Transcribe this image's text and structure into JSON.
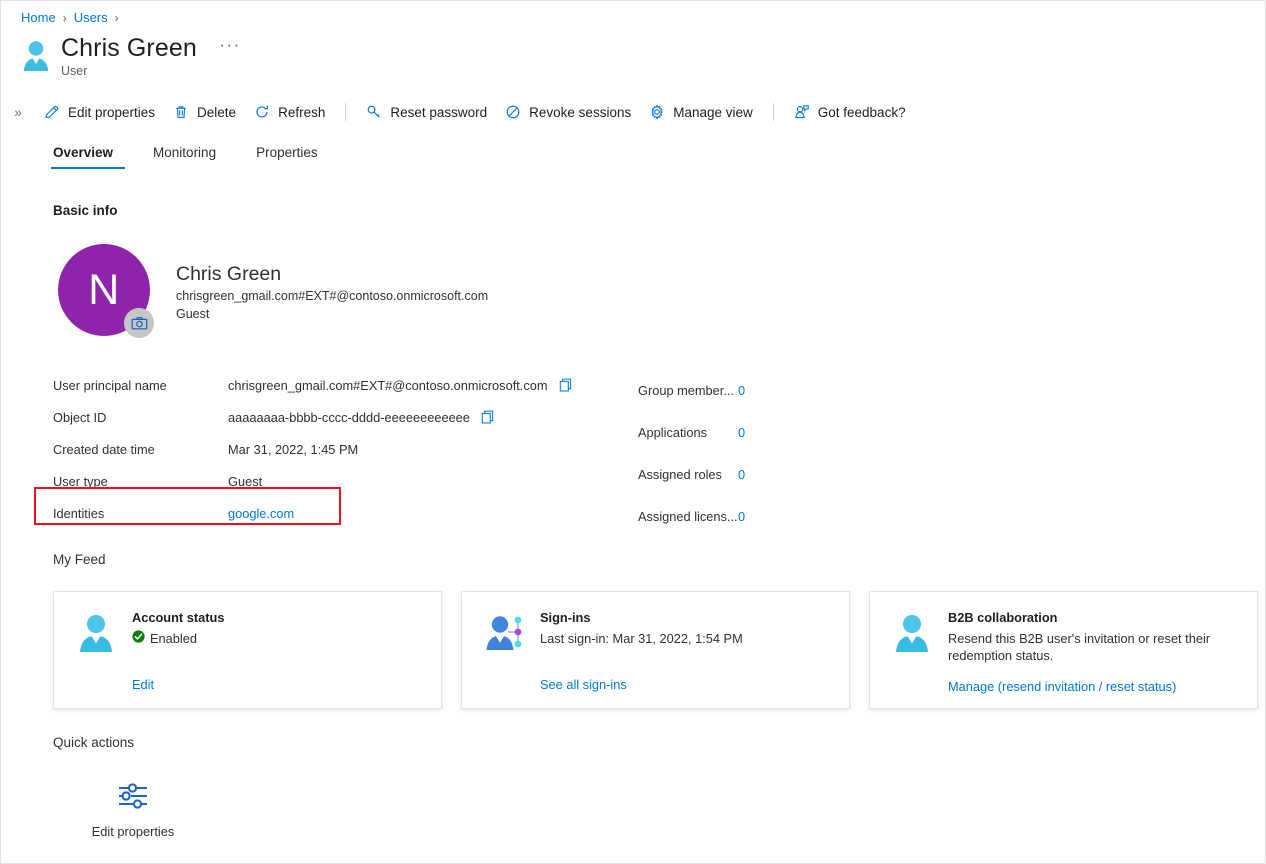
{
  "breadcrumb": {
    "items": [
      "Home",
      "Users"
    ],
    "separator": "›"
  },
  "header": {
    "title": "Chris Green",
    "subtitle": "User",
    "overflow_label": "···",
    "user_icon": "user-icon"
  },
  "commandbar": {
    "expand_label": "»",
    "commands": [
      {
        "label": "Edit properties",
        "icon": "pencil-icon"
      },
      {
        "label": "Delete",
        "icon": "trash-icon"
      },
      {
        "label": "Refresh",
        "icon": "refresh-icon"
      },
      {
        "label": "Reset password",
        "icon": "key-icon"
      },
      {
        "label": "Revoke sessions",
        "icon": "block-icon"
      },
      {
        "label": "Manage view",
        "icon": "gear-icon"
      },
      {
        "label": "Got feedback?",
        "icon": "feedback-icon"
      }
    ]
  },
  "tabs": [
    {
      "label": "Overview",
      "active": true
    },
    {
      "label": "Monitoring",
      "active": false
    },
    {
      "label": "Properties",
      "active": false
    }
  ],
  "sections": {
    "basic_info": "Basic info",
    "my_feed": "My Feed",
    "quick_actions": "Quick actions"
  },
  "profile": {
    "initial": "N",
    "avatar_color": "#8e24aa",
    "camera_badge": "camera-icon",
    "name": "Chris Green",
    "upn": "chrisgreen_gmail.com#EXT#@contoso.onmicrosoft.com",
    "type": "Guest"
  },
  "properties_left": [
    {
      "label": "User principal name",
      "value": "chrisgreen_gmail.com#EXT#@contoso.onmicrosoft.com",
      "copy": true,
      "link": false
    },
    {
      "label": "Object ID",
      "value": "aaaaaaaa-bbbb-cccc-dddd-eeeeeeeeeeee",
      "copy": true,
      "link": false
    },
    {
      "label": "Created date time",
      "value": "Mar 31, 2022, 1:45 PM",
      "copy": false,
      "link": false
    },
    {
      "label": "User type",
      "value": "Guest",
      "copy": false,
      "link": false
    },
    {
      "label": "Identities",
      "value": "google.com",
      "copy": false,
      "link": true
    }
  ],
  "properties_right": [
    {
      "label": "Group member...",
      "value": "0"
    },
    {
      "label": "Applications",
      "value": "0"
    },
    {
      "label": "Assigned roles",
      "value": "0"
    },
    {
      "label": "Assigned licens...",
      "value": "0"
    }
  ],
  "annotation": {
    "color": "#e81123",
    "target": "Identities row"
  },
  "cards": [
    {
      "icon": "user-icon",
      "title": "Account status",
      "status_icon": "check-circle-icon",
      "status_text": "Enabled",
      "link": "Edit"
    },
    {
      "icon": "sign-ins-icon",
      "title": "Sign-ins",
      "text": "Last sign-in: Mar 31, 2022, 1:54 PM",
      "link": "See all sign-ins"
    },
    {
      "icon": "user-icon",
      "title": "B2B collaboration",
      "text": "Resend this B2B user's invitation or reset their redemption status.",
      "link": "Manage (resend invitation / reset status)"
    }
  ],
  "quick_actions": [
    {
      "icon": "sliders-icon",
      "label": "Edit properties"
    }
  ],
  "colors": {
    "accent": "#0078d4",
    "annotation": "#e81123",
    "success": "#107c10",
    "avatar": "#8e24aa"
  }
}
